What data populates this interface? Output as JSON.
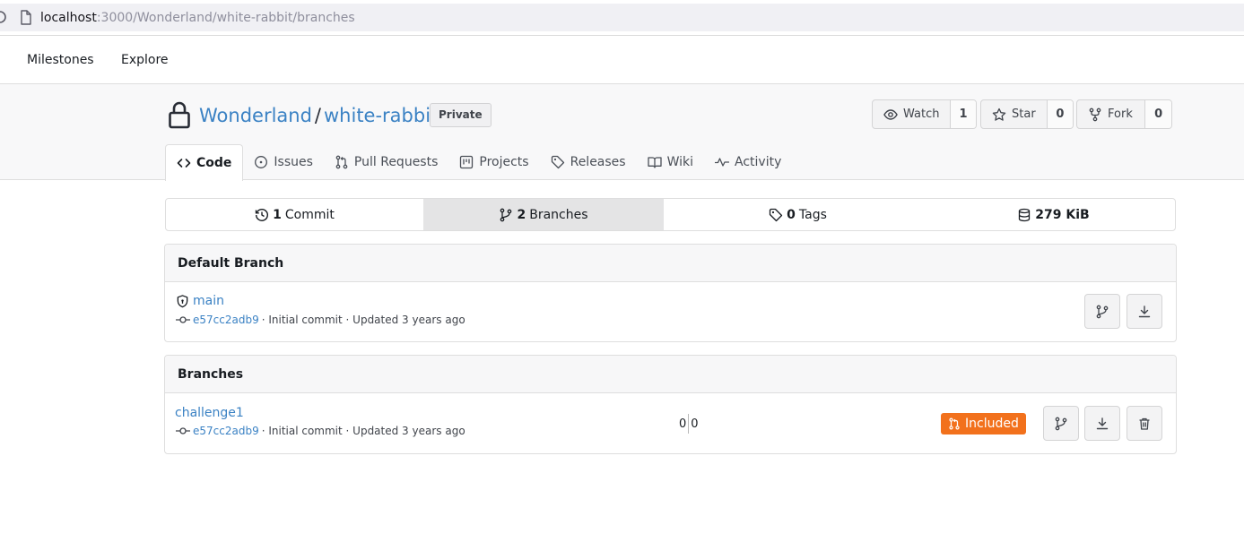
{
  "browser": {
    "url_host": "localhost",
    "url_path": ":3000/Wonderland/white-rabbit/branches"
  },
  "navbar": {
    "items": [
      "Milestones",
      "Explore"
    ]
  },
  "repo": {
    "owner": "Wonderland",
    "separator": "/",
    "name": "white-rabbit",
    "visibility_badge": "Private",
    "watch": {
      "label": "Watch",
      "count": "1"
    },
    "star": {
      "label": "Star",
      "count": "0"
    },
    "fork": {
      "label": "Fork",
      "count": "0"
    },
    "tabs": [
      {
        "label": "Code",
        "icon": "code-icon",
        "active": true
      },
      {
        "label": "Issues",
        "icon": "issue-icon"
      },
      {
        "label": "Pull Requests",
        "icon": "pull-request-icon"
      },
      {
        "label": "Projects",
        "icon": "project-icon"
      },
      {
        "label": "Releases",
        "icon": "tag-icon"
      },
      {
        "label": "Wiki",
        "icon": "book-icon"
      },
      {
        "label": "Activity",
        "icon": "pulse-icon"
      }
    ]
  },
  "stats": {
    "commits": {
      "count": "1",
      "label": "Commit"
    },
    "branches": {
      "count": "2",
      "label": "Branches"
    },
    "tags": {
      "count": "0",
      "label": "Tags"
    },
    "size": {
      "value": "279 KiB"
    }
  },
  "default_branch": {
    "header": "Default Branch",
    "name": "main",
    "sha": "e57cc2adb9",
    "commit_message": "· Initial commit · Updated 3 years ago"
  },
  "branches": {
    "header": "Branches",
    "items": [
      {
        "name": "challenge1",
        "sha": "e57cc2adb9",
        "commit_message": "· Initial commit · Updated 3 years ago",
        "ahead": "0",
        "behind": "0",
        "status_label": "Included"
      }
    ]
  },
  "colors": {
    "link": "#3b82c4",
    "included_badge": "#f2711c",
    "header_bg": "#f8f8f9"
  }
}
